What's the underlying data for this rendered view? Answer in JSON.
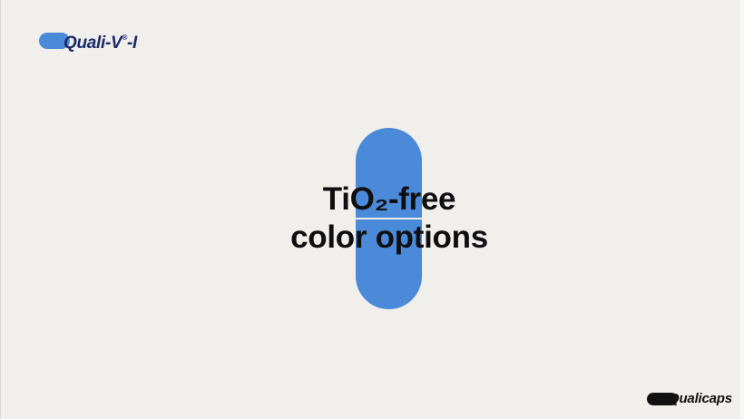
{
  "brand_top": {
    "name": "Quali-V",
    "mark": "®",
    "suffix": "-I",
    "pill_color": "#4a8ad8",
    "text_color": "#1b2a6b"
  },
  "headline": {
    "line1": "TiO₂-free",
    "line2": "color options"
  },
  "capsule": {
    "color": "#4a8ad8"
  },
  "brand_bottom": {
    "name": "Qualicaps",
    "color": "#111111"
  },
  "background_color": "#f0efeb"
}
